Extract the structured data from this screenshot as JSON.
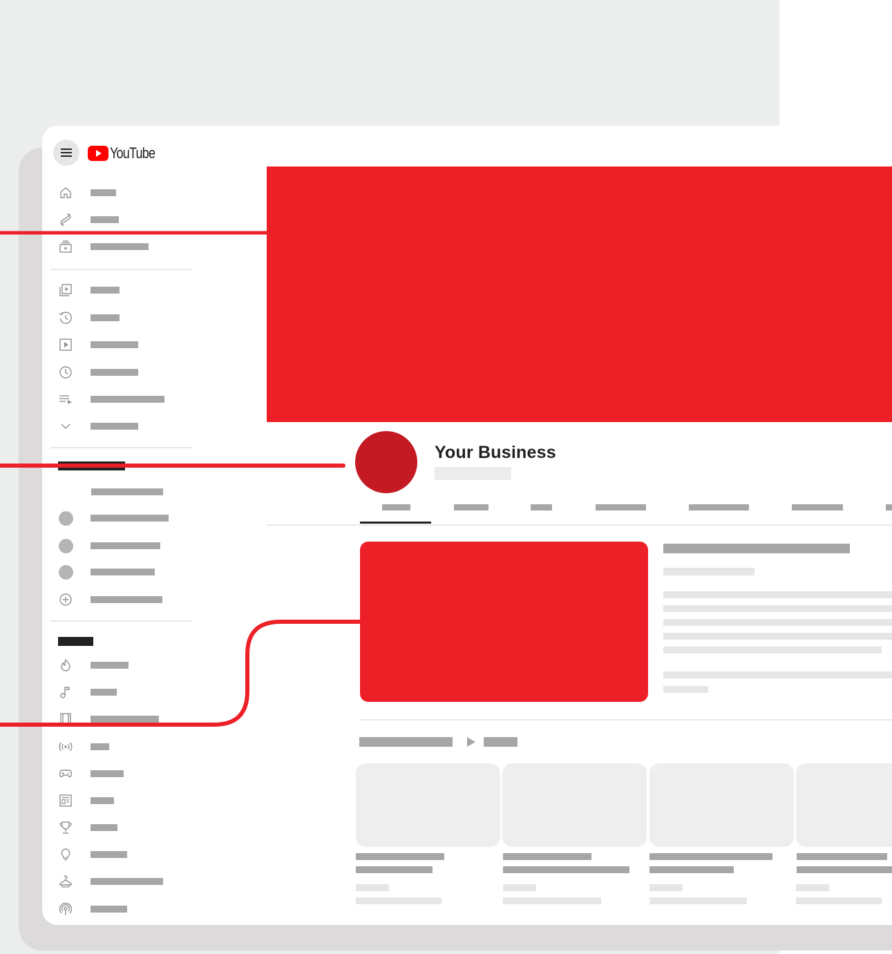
{
  "app": {
    "logo_text": "YouTube"
  },
  "channel": {
    "name": "Your Business"
  },
  "colors": {
    "brand_red": "#ed2028",
    "avatar_red": "#c41a24",
    "placeholder_gray": "#a6a6a6",
    "placeholder_light": "#e6e6e6"
  },
  "sidebar": {
    "primary_icons": [
      "home-icon",
      "shorts-icon",
      "subscriptions-icon"
    ],
    "library_icons": [
      "library-icon",
      "history-icon",
      "your-videos-icon",
      "watch-later-icon",
      "playlist-icon",
      "show-more-chevron-icon"
    ],
    "explore_icons": [
      "trending-icon",
      "music-icon",
      "movies-icon",
      "live-icon",
      "gaming-icon",
      "news-icon",
      "sports-icon",
      "learning-icon",
      "fashion-icon",
      "podcasts-icon"
    ],
    "subscription_channels": 3
  }
}
